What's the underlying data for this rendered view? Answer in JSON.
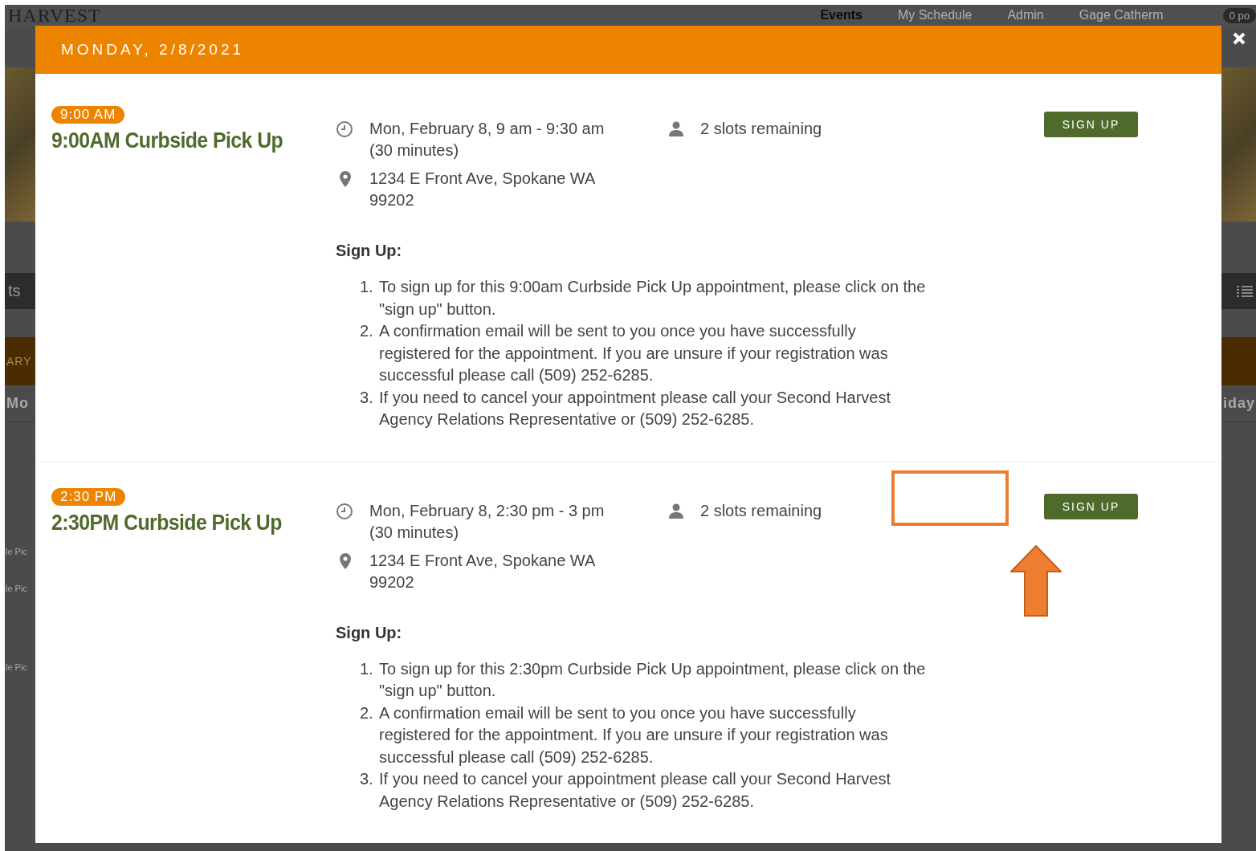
{
  "background_page": {
    "logo": "HARVEST",
    "nav": [
      {
        "label": "Events",
        "selected": true
      },
      {
        "label": "My Schedule",
        "selected": false
      },
      {
        "label": "Admin",
        "selected": false
      },
      {
        "label": "Gage Catherm",
        "selected": false
      }
    ],
    "points_badge": "0 po",
    "left_fragments": [
      "ts",
      "ARY",
      "Mo",
      "le Pic",
      "le Pic",
      "le Pic"
    ],
    "right_fragments": [
      "iday"
    ]
  },
  "modal": {
    "title": "MONDAY, 2/8/2021",
    "events": [
      {
        "time_badge": "9:00 AM",
        "title": "9:00AM Curbside Pick Up",
        "when": "Mon, February 8, 9 am - 9:30 am (30 minutes)",
        "slots": "2 slots remaining",
        "address": "1234 E Front Ave, Spokane WA 99202",
        "sign_up_heading": "Sign Up:",
        "steps": [
          {
            "number": "1.",
            "text": "To sign up for this 9:00am Curbside Pick Up appointment, please click on the \"sign up\" button."
          },
          {
            "number": "2.",
            "text": "A confirmation email will be sent to you once you have successfully registered for the appointment. If you are unsure if your registration was successful please call (509) 252-6285."
          },
          {
            "number": "3.",
            "text": "If you need to cancel your appointment please call your Second Harvest Agency Relations Representative or (509) 252-6285."
          }
        ],
        "button": "SIGN UP",
        "highlighted": false
      },
      {
        "time_badge": "2:30 PM",
        "title": "2:30PM Curbside Pick Up",
        "when": "Mon, February 8, 2:30 pm - 3 pm (30 minutes)",
        "slots": "2 slots remaining",
        "address": "1234 E Front Ave, Spokane WA 99202",
        "sign_up_heading": "Sign Up:",
        "steps": [
          {
            "number": "1.",
            "text": "To sign up for this 2:30pm Curbside Pick Up appointment, please click on the \"sign up\" button."
          },
          {
            "number": "2.",
            "text": "A confirmation email will be sent to you once you have successfully registered for the appointment. If you are unsure if your registration was successful please call (509) 252-6285."
          },
          {
            "number": "3.",
            "text": "If you need to cancel your appointment please call your Second Harvest Agency Relations Representative or (509) 252-6285."
          }
        ],
        "button": "SIGN UP",
        "highlighted": true
      }
    ]
  }
}
